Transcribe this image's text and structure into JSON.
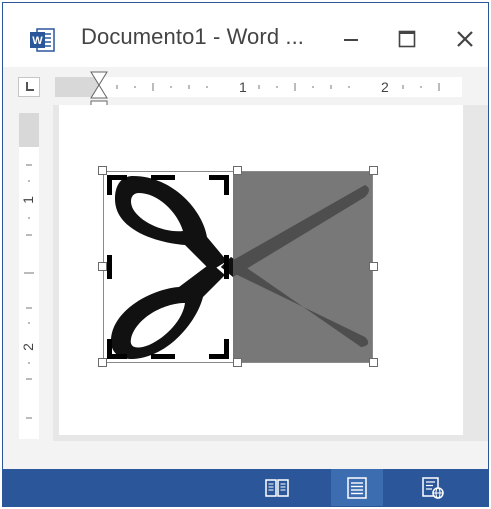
{
  "window": {
    "title": "Documento1 - Word ...",
    "app_icon": "word-icon",
    "controls": [
      "minimize-icon",
      "maximize-icon",
      "close-icon"
    ]
  },
  "ruler": {
    "horizontal_numbers": [
      "1",
      "2"
    ],
    "vertical_numbers": [
      "1",
      "2"
    ]
  },
  "document": {
    "image": "scissors-icon",
    "crop_mode": true
  },
  "statusbar": {
    "views": [
      "read-mode-icon",
      "print-layout-icon",
      "web-layout-icon"
    ],
    "active_view": "print-layout-icon"
  },
  "colors": {
    "accent": "#2b579a",
    "active_view_bg": "#3c6db0",
    "cropped_area": "#787878"
  }
}
